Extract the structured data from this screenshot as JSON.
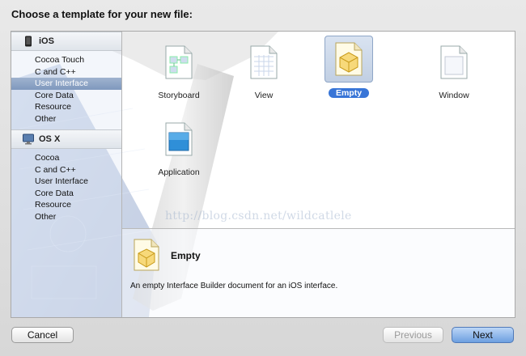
{
  "dialog": {
    "title": "Choose a template for your new file:"
  },
  "sidebar": {
    "groups": [
      {
        "name": "iOS",
        "icon": "iphone-icon",
        "items": [
          "Cocoa Touch",
          "C and C++",
          "User Interface",
          "Core Data",
          "Resource",
          "Other"
        ],
        "selected": "User Interface"
      },
      {
        "name": "OS X",
        "icon": "mac-icon",
        "items": [
          "Cocoa",
          "C and C++",
          "User Interface",
          "Core Data",
          "Resource",
          "Other"
        ]
      }
    ]
  },
  "templates": [
    {
      "name": "Storyboard",
      "icon": "storyboard-file-icon"
    },
    {
      "name": "View",
      "icon": "view-file-icon"
    },
    {
      "name": "Empty",
      "icon": "empty-file-icon",
      "selected": true
    },
    {
      "name": "Window",
      "icon": "window-file-icon"
    },
    {
      "name": "Application",
      "icon": "application-file-icon"
    }
  ],
  "description": {
    "title": "Empty",
    "text": "An empty Interface Builder document for an iOS interface."
  },
  "watermark": "http://blog.csdn.net/wildcatlele",
  "buttons": {
    "cancel": "Cancel",
    "previous": "Previous",
    "next": "Next"
  },
  "colors": {
    "selection": "#3875d7",
    "sidebar_selection": "#8aa1c4"
  }
}
